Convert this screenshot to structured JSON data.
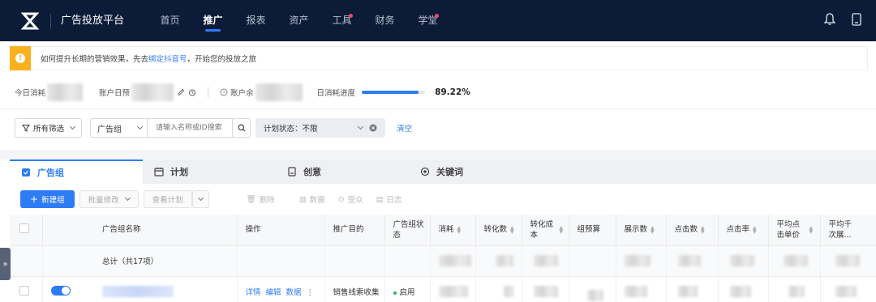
{
  "nav": {
    "brand": "广告投放平台",
    "items": [
      {
        "label": "首页",
        "active": false,
        "dot": false
      },
      {
        "label": "推广",
        "active": true,
        "dot": false
      },
      {
        "label": "报表",
        "active": false,
        "dot": false
      },
      {
        "label": "资产",
        "active": false,
        "dot": false
      },
      {
        "label": "工具",
        "active": false,
        "dot": true
      },
      {
        "label": "财务",
        "active": false,
        "dot": false
      },
      {
        "label": "学堂",
        "active": false,
        "dot": true
      }
    ]
  },
  "banner": {
    "text_before": "如何提升长期的营销效果，先去",
    "link": "绑定抖音号",
    "text_after": "，开始您的投放之旅"
  },
  "stats": {
    "today_spend_label": "今日消耗",
    "account_budget_label": "账户日预",
    "account_balance_label": "账户余",
    "daily_progress_label": "日消耗进度",
    "daily_progress_value": "89.22%",
    "daily_progress_fraction": 0.8922
  },
  "filters": {
    "all_filters": "所有筛选",
    "group_select": "广告组",
    "search_placeholder": "请输入名称或ID搜索",
    "plan_status_chip": "计划状态：不限",
    "clear": "清空"
  },
  "tabs": [
    {
      "label": "广告组",
      "icon": "checkbox-icon",
      "active": true
    },
    {
      "label": "计划",
      "icon": "calendar-icon",
      "active": false
    },
    {
      "label": "创意",
      "icon": "creative-icon",
      "active": false
    },
    {
      "label": "关键词",
      "icon": "target-icon",
      "active": false
    }
  ],
  "toolbar": {
    "new_group": "新建组",
    "batch_edit": "批量修改",
    "view_plan": "查看计划",
    "delete": "删除",
    "data": "数据",
    "audience": "受众",
    "log": "日志"
  },
  "table": {
    "headers": [
      "广告组名称",
      "操作",
      "推广目的",
      "广告组状态",
      "消耗",
      "转化数",
      "转化成本",
      "组预算",
      "展示数",
      "点击数",
      "点击率",
      "平均点击单价",
      "平均千次展..."
    ],
    "total_label": "总计（共17项）",
    "rows": [
      {
        "actions": [
          "详情",
          "编辑",
          "数据"
        ],
        "purpose": "销售线索收集",
        "status": "启用"
      }
    ]
  },
  "colors": {
    "primary": "#2d7cf6",
    "nav_bg": "#0c1c38",
    "warning": "#fbb11e"
  }
}
